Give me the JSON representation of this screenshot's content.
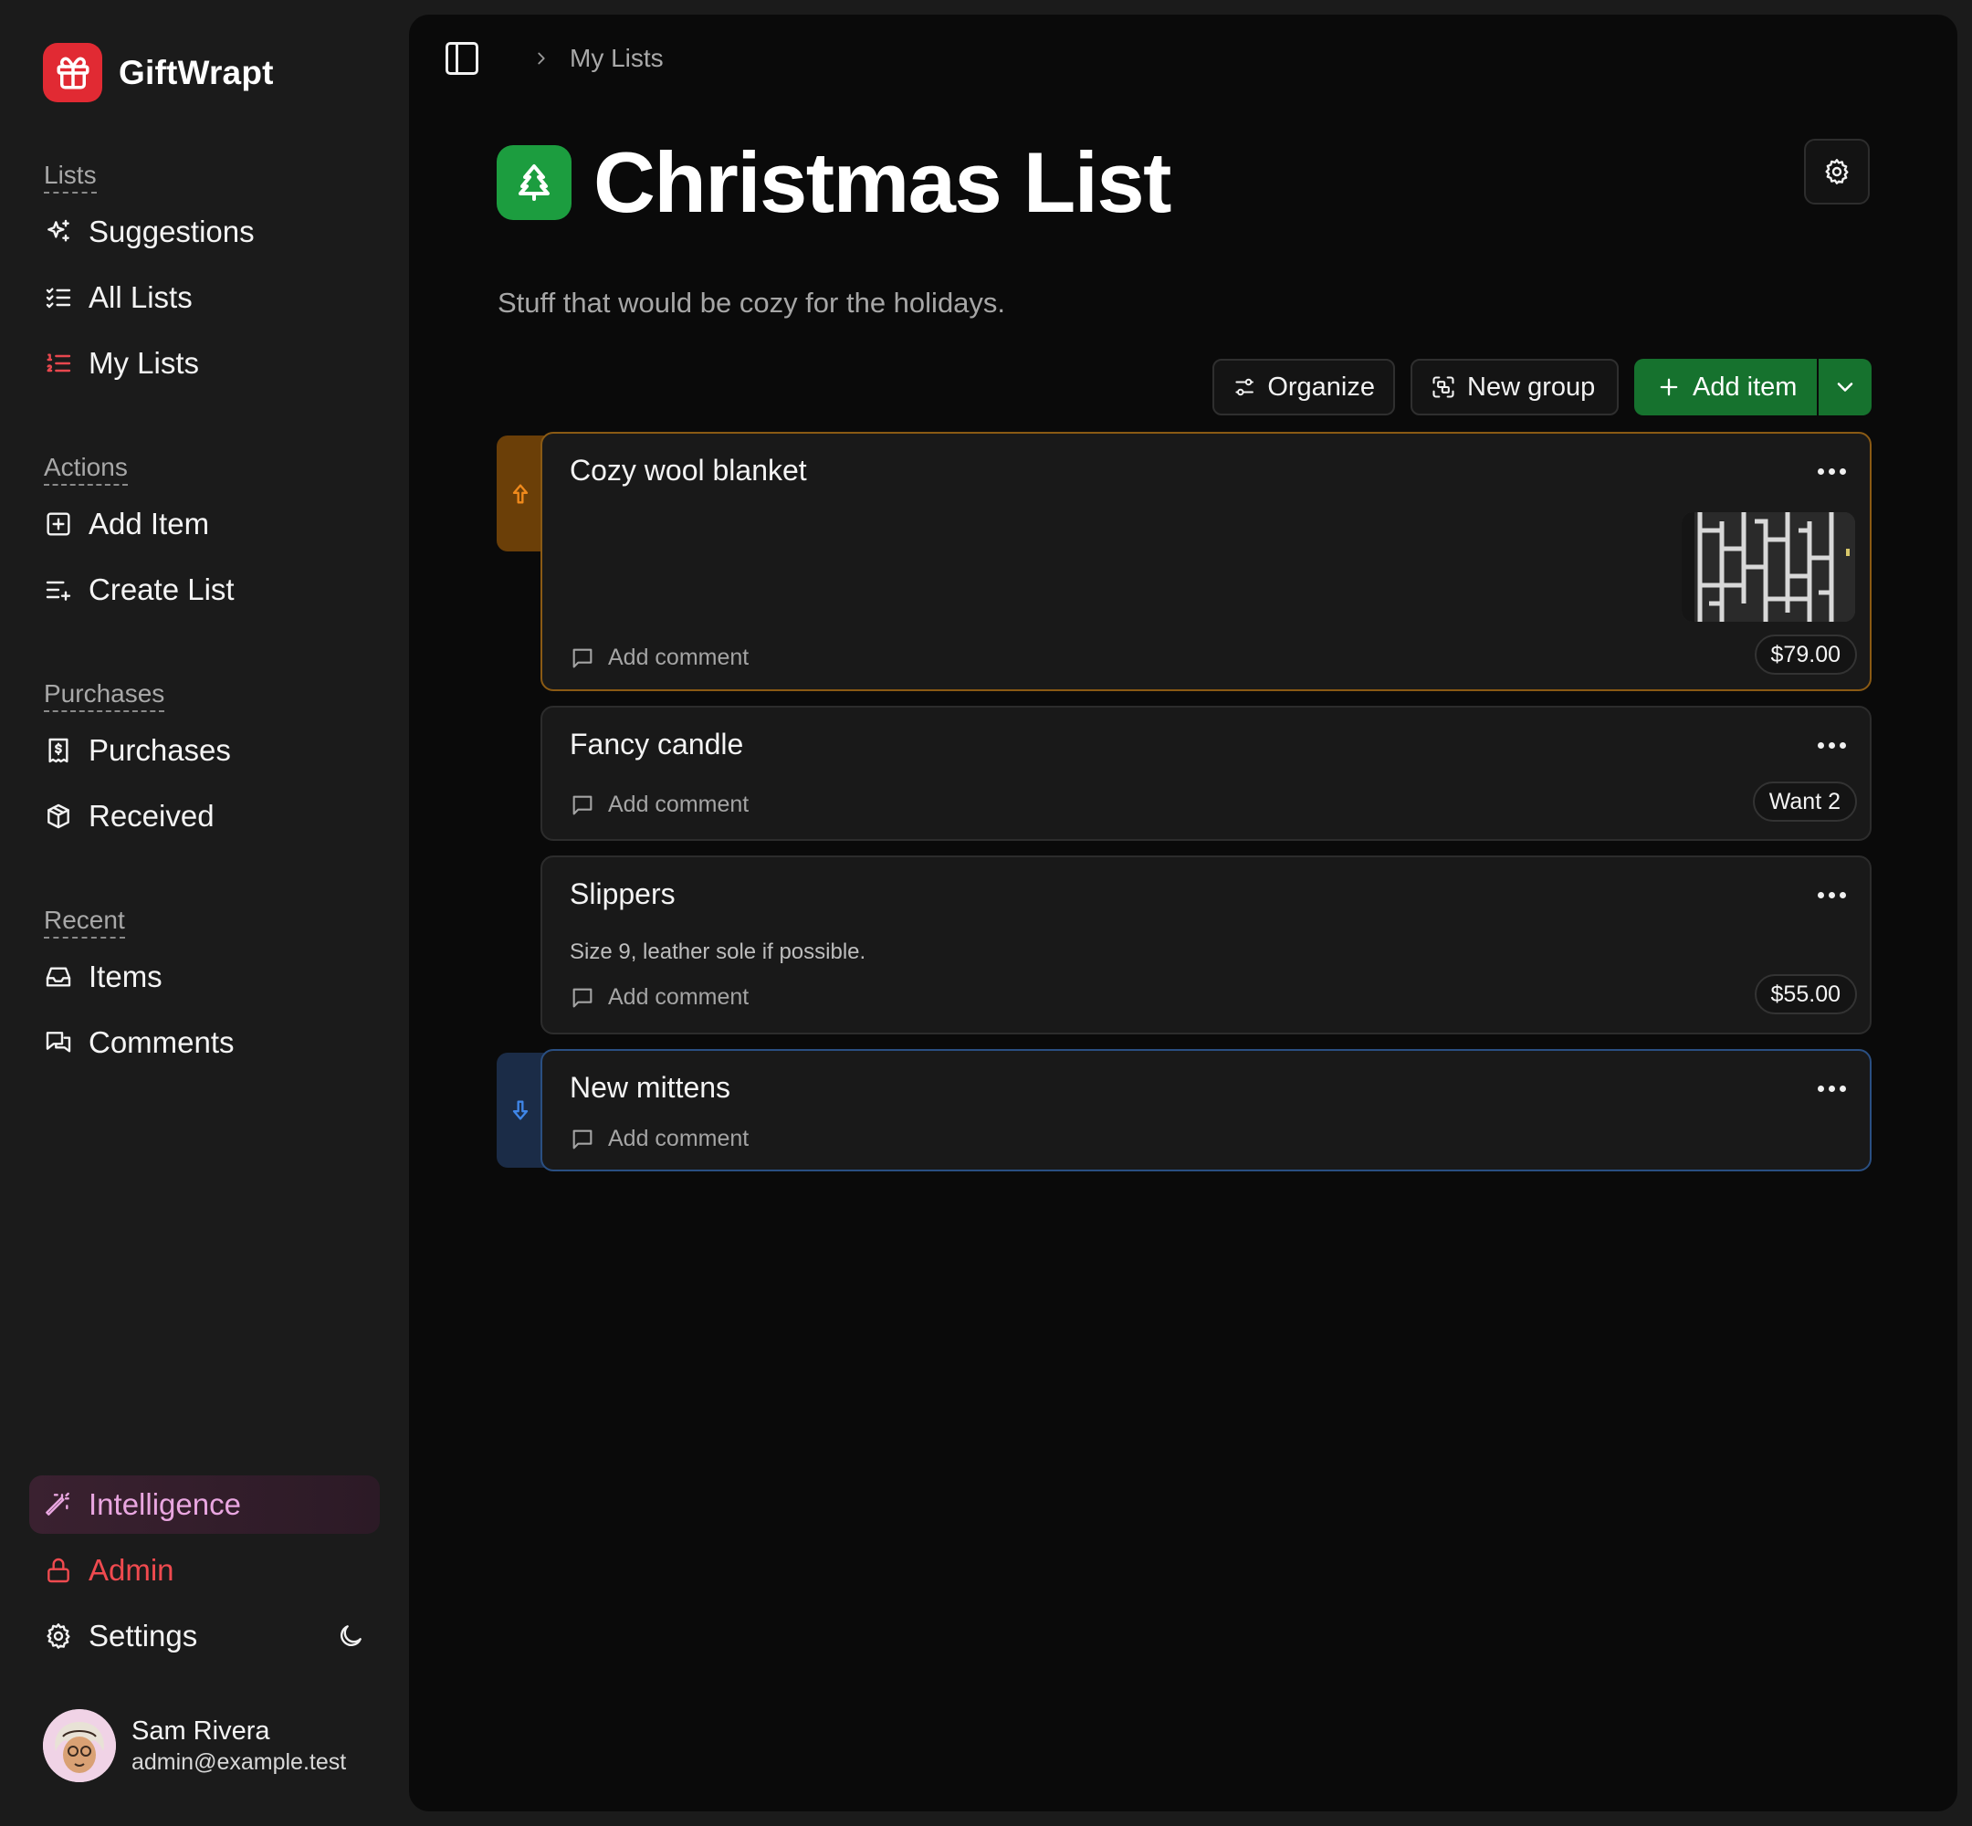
{
  "app": {
    "name": "GiftWrapt"
  },
  "sidebar": {
    "sections": {
      "lists": "Lists",
      "actions": "Actions",
      "purchases": "Purchases",
      "recent": "Recent"
    },
    "items": {
      "suggestions": "Suggestions",
      "all_lists": "All Lists",
      "my_lists": "My Lists",
      "add_item": "Add Item",
      "create_list": "Create List",
      "purchases": "Purchases",
      "received": "Received",
      "items": "Items",
      "comments": "Comments",
      "intelligence": "Intelligence",
      "admin": "Admin",
      "settings": "Settings"
    },
    "user": {
      "name": "Sam Rivera",
      "email": "admin@example.test"
    }
  },
  "breadcrumb": {
    "current": "My Lists"
  },
  "page": {
    "title": "Christmas List",
    "description": "Stuff that would be cozy for the holidays."
  },
  "toolbar": {
    "organize": "Organize",
    "new_group": "New group",
    "add_item": "Add item"
  },
  "items": [
    {
      "title": "Cozy wool blanket",
      "note": "",
      "comment": "Add comment",
      "badge": "$79.00",
      "priority": "high",
      "has_image": true
    },
    {
      "title": "Fancy candle",
      "note": "",
      "comment": "Add comment",
      "badge": "Want 2",
      "priority": "",
      "has_image": false
    },
    {
      "title": "Slippers",
      "note": "Size 9, leather sole if possible.",
      "comment": "Add comment",
      "badge": "$55.00",
      "priority": "",
      "has_image": false
    },
    {
      "title": "New mittens",
      "note": "",
      "comment": "Add comment",
      "badge": "",
      "priority": "low",
      "has_image": false
    }
  ],
  "colors": {
    "accent_green": "#16722e",
    "brand_red": "#e12a33",
    "high_priority": "#c47a14",
    "low_priority": "#2f6fd0",
    "intelligence": "#e9a6e0",
    "admin": "#f04a4f"
  }
}
